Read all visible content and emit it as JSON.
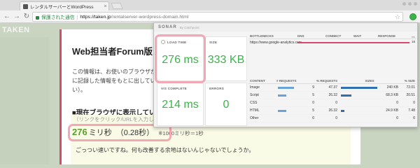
{
  "browser": {
    "tab_title": "レンタルサーバーとWordPress",
    "tab_close": "×",
    "secure_label": "保護された通信",
    "separator": "|",
    "url_host": "https://taken.jp",
    "url_path": "/rentalserver-wordpress-domain.html",
    "back": "←",
    "forward": "→",
    "reload": "↻",
    "star": "☆"
  },
  "page": {
    "logo": "TAKEN",
    "title": "Web担当者Forum版",
    "paragraph": "この情報は、お使いのブラウザが に記録した情報をもとに出してい い）。",
    "section_heading": "■現在ブラウザに表示してい",
    "small_note": "（リンクをクリック/URLを入力した瞬間から、画像や広告などの読み込みまでページ表示が完了するまでの時間）",
    "load_num": "276",
    "load_unit": "ミリ秒",
    "load_sec": "（0.28秒）",
    "load_hint": "※1000ミリ秒＝1秒",
    "comment": "ごっつい速いですね。何も改善する余地はないんじゃないでしょうか。"
  },
  "sonar": {
    "brand": "SONAR",
    "by": "By Catchpoint",
    "load_time": {
      "label": "LOAD TIME",
      "value": "276 ms"
    },
    "size": {
      "label": "SIZE",
      "value": "333 KB"
    },
    "vis_complete": {
      "label": "VIS COMPLETE",
      "value": "214 ms"
    },
    "errors": {
      "label": "ERRORS",
      "value": "0"
    },
    "bottlenecks": {
      "headers": [
        "BOTTLENECKS",
        "DNS",
        "CONNECT",
        "WAIT",
        "RESPONSE"
      ],
      "ms_label": "ms",
      "row": {
        "host": "https://www.google-analytics.com",
        "value": "18"
      }
    },
    "content": {
      "headers": [
        "CONTENT",
        "# REQUESTS",
        "% REQUESTS",
        "SIZES",
        "% SIZE"
      ],
      "rows": [
        {
          "type": "Image",
          "requests": "9",
          "req_pct": "47.37",
          "size": "240 KB",
          "size_pct": "72.01",
          "req_frac": 0.47,
          "size_frac": 0.72
        },
        {
          "type": "Script",
          "requests": "5",
          "req_pct": "26.32",
          "size": "68.3 KB",
          "size_pct": "20.51",
          "req_frac": 0.26,
          "size_frac": 0.21
        },
        {
          "type": "CSS",
          "requests": "0",
          "req_pct": "0",
          "size": "0",
          "size_pct": "0",
          "req_frac": 0,
          "size_frac": 0
        },
        {
          "type": "HTML",
          "requests": "5",
          "req_pct": "26.32",
          "size": "24.9 KB",
          "size_pct": "7.48",
          "req_frac": 0.26,
          "size_frac": 0.07
        },
        {
          "type": "Other",
          "requests": "0",
          "req_pct": "0",
          "size": "0",
          "size_pct": "0",
          "req_frac": 0,
          "size_frac": 0
        }
      ]
    }
  }
}
